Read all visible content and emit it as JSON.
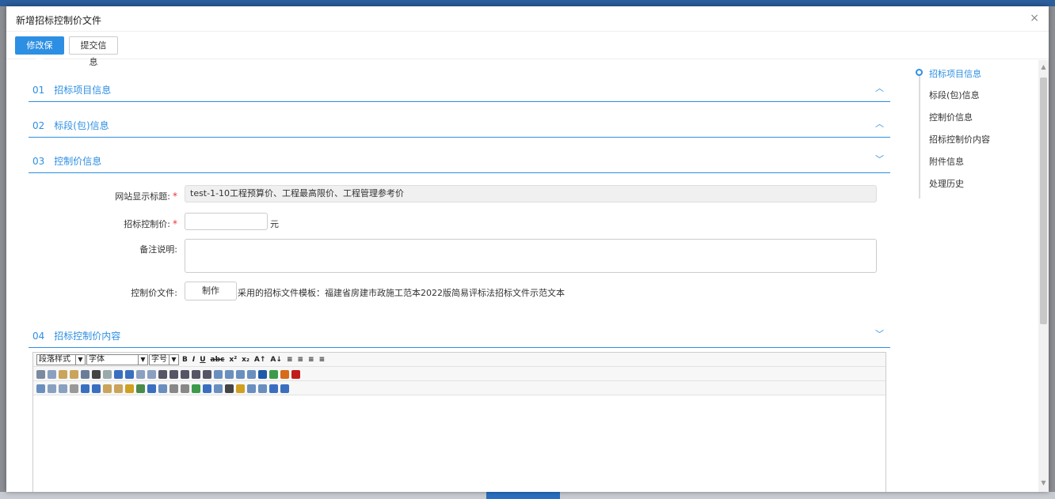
{
  "dialog": {
    "title": "新增招标控制价文件",
    "close": "×"
  },
  "toolbar": {
    "save_label": "修改保存",
    "submit_label": "提交信息"
  },
  "sections": [
    {
      "num": "01",
      "title": "招标项目信息",
      "chevron": "︿"
    },
    {
      "num": "02",
      "title": "标段(包)信息",
      "chevron": "︿"
    },
    {
      "num": "03",
      "title": "控制价信息",
      "chevron": "﹀"
    },
    {
      "num": "04",
      "title": "招标控制价内容",
      "chevron": "﹀"
    }
  ],
  "form": {
    "site_title_label": "网站显示标题:",
    "site_title_value": "test-1-10工程预算价、工程最高限价、工程管理参考价",
    "price_label": "招标控制价:",
    "price_value": "",
    "price_unit": "元",
    "remark_label": "备注说明:",
    "remark_value": "",
    "file_label": "控制价文件:",
    "make_button": "制作",
    "template_note": "采用的招标文件模板：福建省房建市政施工范本2022版简易评标法招标文件示范文本",
    "required_mark": "*"
  },
  "editor": {
    "paragraph_select": "段落样式",
    "font_select": "字体",
    "size_select": "字号"
  },
  "right_nav": {
    "items": [
      "招标项目信息",
      "标段(包)信息",
      "控制价信息",
      "招标控制价内容",
      "附件信息",
      "处理历史"
    ],
    "active_index": 0
  },
  "colors": {
    "accent": "#2d8fe3",
    "required": "#e33333"
  }
}
